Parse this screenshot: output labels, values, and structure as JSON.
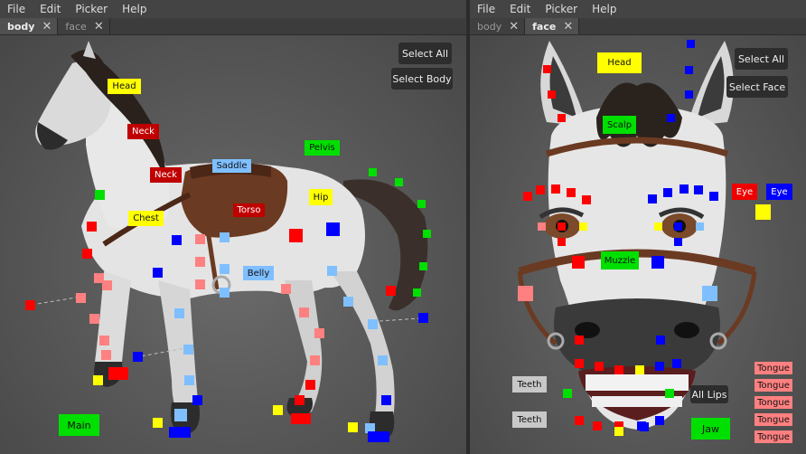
{
  "left": {
    "menu": [
      "File",
      "Edit",
      "Picker",
      "Help"
    ],
    "tabs": [
      {
        "label": "body",
        "close": "✕"
      },
      {
        "label": "face",
        "close": "✕"
      }
    ],
    "buttons": {
      "select_all": "Select All",
      "select_body": "Select Body"
    },
    "labels": {
      "head": "Head",
      "neck1": "Neck",
      "neck2": "Neck",
      "saddle": "Saddle",
      "pelvis": "Pelvis",
      "hip": "Hip",
      "chest": "Chest",
      "torso": "Torso",
      "belly": "Belly",
      "main": "Main"
    }
  },
  "right": {
    "menu": [
      "File",
      "Edit",
      "Picker",
      "Help"
    ],
    "tabs": [
      {
        "label": "body",
        "close": "✕"
      },
      {
        "label": "face",
        "close": "✕"
      }
    ],
    "buttons": {
      "select_all": "Select All",
      "select_face": "Select Face",
      "all_lips": "All Lips"
    },
    "labels": {
      "head": "Head",
      "scalp": "Scalp",
      "eye_l": "Eye",
      "eye_r": "Eye",
      "muzzle": "Muzzle",
      "teeth_top": "Teeth",
      "teeth_bottom": "Teeth",
      "jaw": "Jaw",
      "tongue": [
        "Tongue",
        "Tongue",
        "Tongue",
        "Tongue",
        "Tongue"
      ]
    }
  },
  "colors": {
    "red": "#ff0000",
    "blue": "#0000ff",
    "green": "#00e000",
    "yellow": "#ffff00",
    "pink": "#ff8080",
    "lightblue": "#7fbfff",
    "darkred": "#cc0000"
  }
}
